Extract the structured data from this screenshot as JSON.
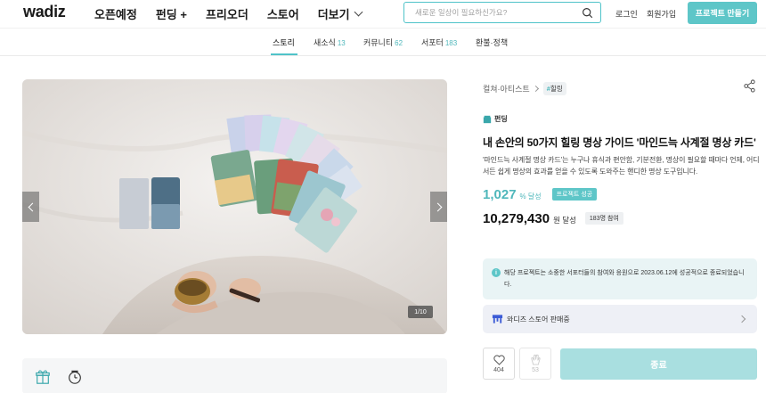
{
  "header": {
    "logo": "wadiz",
    "menu": [
      "오픈예정",
      "펀딩 +",
      "프리오더",
      "스토어",
      "더보기"
    ],
    "search_placeholder": "새로운 일상이 필요하신가요?",
    "login": "로그인",
    "signup": "회원가입",
    "make_project": "프로젝트 만들기"
  },
  "tabs": [
    {
      "label": "스토리",
      "count": ""
    },
    {
      "label": "새소식",
      "count": "13"
    },
    {
      "label": "커뮤니티",
      "count": "62"
    },
    {
      "label": "서포터",
      "count": "183"
    },
    {
      "label": "환불·정책",
      "count": ""
    }
  ],
  "gallery": {
    "counter": "1/10"
  },
  "project": {
    "category": "컬쳐·아티스트",
    "tag_hash": "#",
    "tag": "힐링",
    "type": "펀딩",
    "title": "내 손안의 50가지 힐링 명상 가이드 '마인드늑 사계절 명상 카드'",
    "description": "'마인드늑 사계절 명상 카드'는 누구나 휴식과 편안함, 기분전환, 명상이 필요할 때마다 언제, 어디서든 쉽게 명상의 효과를 얻을 수 있도록 도와주는 핸디한 명상 도구입니다.",
    "rate": "1,027",
    "rate_unit": "% 달성",
    "success_badge": "프로젝트 성공",
    "amount": "10,279,430",
    "amount_unit": "원 달성",
    "supporters": "183명 참여"
  },
  "notice": {
    "text": "해당 프로젝트는 소중한 서포터들의 참여와 응원으로 2023.06.12에 성공적으로 종료되었습니다."
  },
  "store": {
    "label": "와디즈 스토어 판매중"
  },
  "actions": {
    "like_count": "404",
    "cheer_count": "53",
    "end_label": "종료"
  },
  "colors": {
    "accent": "#4fc3c9",
    "accent_text": "#4fb7bb",
    "end_button": "#a9dfe0"
  }
}
